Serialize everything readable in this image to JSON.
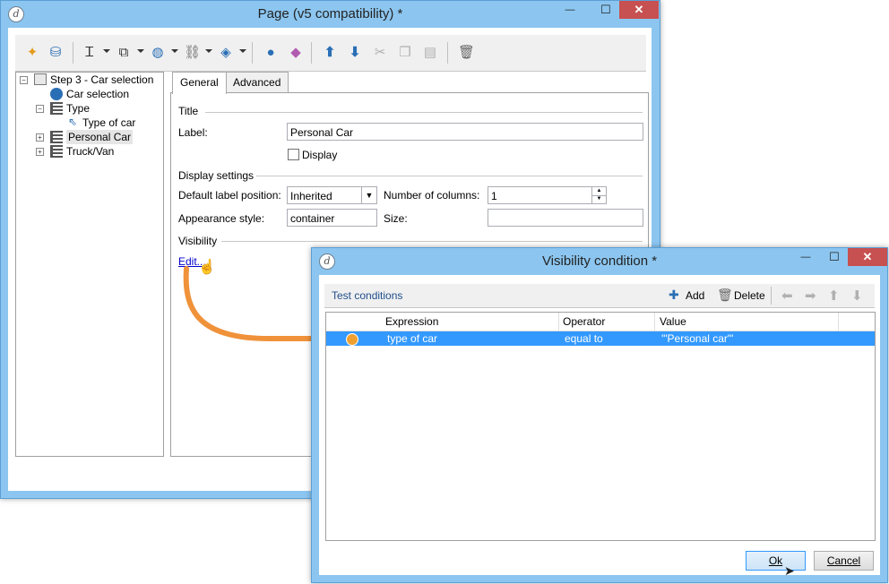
{
  "main_window": {
    "title": "Page (v5 compatibility) *",
    "minimize": "—",
    "maximize": "☐",
    "close": "✕"
  },
  "toolbar_icons": [
    "magic-wand-icon",
    "database-import-icon",
    "text-cursor-icon",
    "edit-field-icon",
    "globe-icon",
    "link-icon",
    "layers-icon",
    "user-icon",
    "shapes-icon",
    "arrow-up-icon",
    "arrow-down-icon",
    "cut-icon",
    "copy-icon",
    "paste-icon",
    "trash-icon"
  ],
  "tree": {
    "items": [
      {
        "label": "Step 3 - Car selection"
      },
      {
        "label": "Car selection"
      },
      {
        "label": "Type"
      },
      {
        "label": "Type of car"
      },
      {
        "label": "Personal Car"
      },
      {
        "label": "Truck/Van"
      }
    ],
    "expanded_symbol": "−",
    "collapsed_symbol": "+"
  },
  "tabs": [
    {
      "label": "General",
      "active": true
    },
    {
      "label": "Advanced",
      "active": false
    }
  ],
  "general": {
    "title_section": "Title",
    "label_label": "Label:",
    "label_value": "Personal Car",
    "display_label": "Display",
    "display_checked": false,
    "display_settings_section": "Display settings",
    "default_label_position_label": "Default label position:",
    "default_label_position_value": "Inherited",
    "number_of_columns_label": "Number of columns:",
    "number_of_columns_value": "1",
    "appearance_style_label": "Appearance style:",
    "appearance_style_value": "container",
    "size_label": "Size:",
    "size_value": "",
    "visibility_section": "Visibility",
    "edit_link": "Edit..."
  },
  "visibility_dialog": {
    "title": "Visibility condition *",
    "minimize": "—",
    "maximize": "☐",
    "close": "✕",
    "test_conditions": "Test conditions",
    "add_label": "Add",
    "delete_label": "Delete",
    "columns": [
      "Expression",
      "Operator",
      "Value"
    ],
    "rows": [
      {
        "expression": "type of car",
        "operator": "equal to",
        "value": "'\"Personal car\"'"
      }
    ],
    "ok_label": "Ok",
    "cancel_label": "Cancel"
  },
  "colors": {
    "window_frame": "#8cc6f0",
    "selection": "#3399ff",
    "arrow_annotation": "#f0923a",
    "close_button": "#c75050"
  }
}
